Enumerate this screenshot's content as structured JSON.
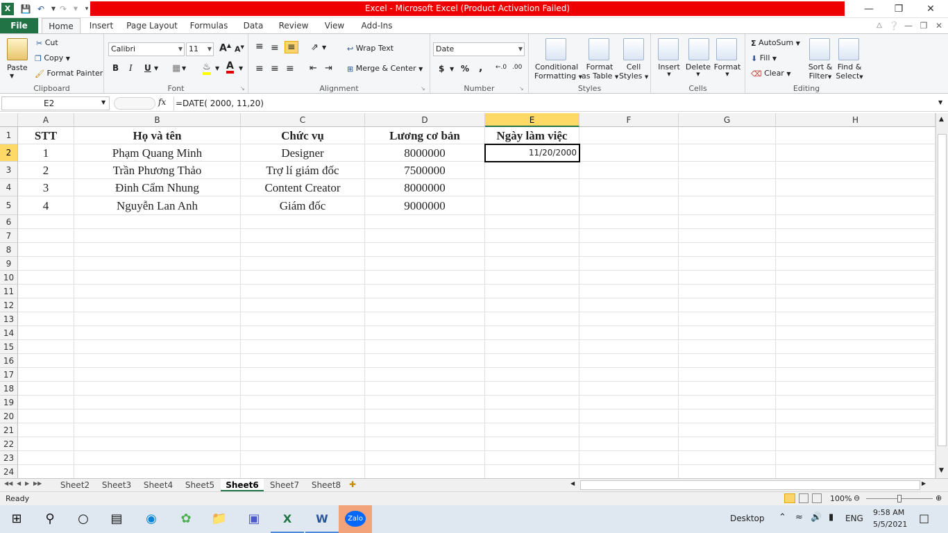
{
  "window": {
    "title": "Excel  -  Microsoft Excel (Product Activation Failed)",
    "minimize": "—",
    "restore": "❐",
    "close": "✕"
  },
  "tabs": [
    {
      "label": "File"
    },
    {
      "label": "Home"
    },
    {
      "label": "Insert"
    },
    {
      "label": "Page Layout"
    },
    {
      "label": "Formulas"
    },
    {
      "label": "Data"
    },
    {
      "label": "Review"
    },
    {
      "label": "View"
    },
    {
      "label": "Add-Ins"
    }
  ],
  "ribbon": {
    "clipboard": {
      "label": "Clipboard",
      "paste": "Paste",
      "cut": "Cut",
      "copy": "Copy",
      "format_painter": "Format Painter"
    },
    "font": {
      "label": "Font",
      "name": "Calibri",
      "size": "11",
      "bold": "B",
      "italic": "I",
      "underline": "U",
      "grow": "A",
      "shrink": "A"
    },
    "alignment": {
      "label": "Alignment",
      "wrap": "Wrap Text",
      "merge": "Merge & Center"
    },
    "number": {
      "label": "Number",
      "format": "Date",
      "currency": "$",
      "percent": "%",
      "comma": ","
    },
    "styles": {
      "label": "Styles",
      "conditional": "Conditional",
      "conditional2": "Formatting",
      "format_table": "Format",
      "format_table2": "as Table",
      "cell_styles": "Cell",
      "cell_styles2": "Styles"
    },
    "cells": {
      "label": "Cells",
      "insert": "Insert",
      "delete": "Delete",
      "format": "Format"
    },
    "editing": {
      "label": "Editing",
      "autosum": "AutoSum",
      "fill": "Fill",
      "clear": "Clear",
      "sort": "Sort &",
      "sort2": "Filter",
      "find": "Find &",
      "find2": "Select"
    }
  },
  "formula_bar": {
    "name_box": "E2",
    "fx": "fx",
    "formula": "=DATE( 2000, 11,20)"
  },
  "grid": {
    "columns": [
      "A",
      "B",
      "C",
      "D",
      "E",
      "F",
      "G",
      "H"
    ],
    "rows": [
      "1",
      "2",
      "3",
      "4",
      "5",
      "6",
      "7",
      "8",
      "9",
      "10",
      "11",
      "12",
      "13",
      "14",
      "15",
      "16",
      "17",
      "18",
      "19",
      "20",
      "21",
      "22",
      "23",
      "24"
    ],
    "header_row": [
      "STT",
      "Họ và tên",
      "Chức vụ",
      "Lương cơ bản",
      "Ngày làm việc"
    ],
    "data": [
      [
        "1",
        "Phạm Quang Minh",
        "Designer",
        "8000000",
        "11/20/2000"
      ],
      [
        "2",
        "Trần Phương Thảo",
        "Trợ lí giám đốc",
        "7500000",
        ""
      ],
      [
        "3",
        "Đinh Cẩm Nhung",
        "Content Creator",
        "8000000",
        ""
      ],
      [
        "4",
        "Nguyễn Lan Anh",
        "Giám đốc",
        "9000000",
        ""
      ]
    ],
    "selected": "E2"
  },
  "sheets": [
    "Sheet2",
    "Sheet3",
    "Sheet4",
    "Sheet5",
    "Sheet6",
    "Sheet7",
    "Sheet8"
  ],
  "active_sheet": "Sheet6",
  "status": {
    "ready": "Ready",
    "zoom": "100%"
  },
  "taskbar": {
    "desktop": "Desktop",
    "lang": "ENG",
    "time": "9:58 AM",
    "date": "5/5/2021",
    "zalo": "Zalo"
  },
  "colors": {
    "excel_green": "#217346",
    "title_red": "#ee0000",
    "selected_header": "#ffd966"
  }
}
